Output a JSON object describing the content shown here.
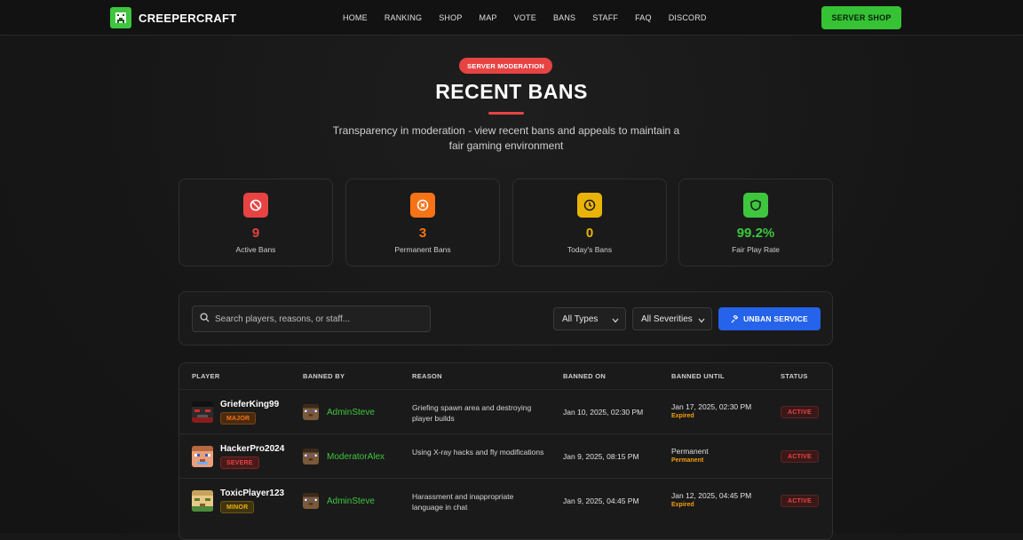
{
  "nav": {
    "brand": "CREEPERCRAFT",
    "items": [
      "HOME",
      "RANKING",
      "SHOP",
      "MAP",
      "VOTE",
      "BANS",
      "STAFF",
      "FAQ",
      "DISCORD"
    ],
    "cta": "SERVER SHOP"
  },
  "hero": {
    "badge": "SERVER MODERATION",
    "title": "RECENT BANS",
    "subtitle": "Transparency in moderation - view recent bans and appeals to maintain a fair gaming environment"
  },
  "stats": [
    {
      "value": "9",
      "label": "Active Bans",
      "icon": "ban-icon",
      "color": "#e74343"
    },
    {
      "value": "3",
      "label": "Permanent Bans",
      "icon": "x-circle-icon",
      "color": "#f97316"
    },
    {
      "value": "0",
      "label": "Today's Bans",
      "icon": "clock-icon",
      "color": "#eab308"
    },
    {
      "value": "99.2%",
      "label": "Fair Play Rate",
      "icon": "shield-icon",
      "color": "#3ec63e"
    }
  ],
  "filters": {
    "search_placeholder": "Search players, reasons, or staff...",
    "type_select": "All Types",
    "severity_select": "All Severities",
    "unban_label": "UNBAN SERVICE"
  },
  "table": {
    "headers": [
      "PLAYER",
      "BANNED BY",
      "REASON",
      "BANNED ON",
      "BANNED UNTIL",
      "STATUS"
    ],
    "rows": [
      {
        "player": "GrieferKing99",
        "severity": "MAJOR",
        "staff": "AdminSteve",
        "reason": "Griefing spawn area and destroying player builds",
        "banned_on": "Jan 10, 2025, 02:30 PM",
        "until": "Jan 17, 2025, 02:30 PM",
        "until_note": "Expired",
        "status": "ACTIVE"
      },
      {
        "player": "HackerPro2024",
        "severity": "SEVERE",
        "staff": "ModeratorAlex",
        "reason": "Using X-ray hacks and fly modifications",
        "banned_on": "Jan 9, 2025, 08:15 PM",
        "until": "Permanent",
        "until_note": "Permanent",
        "status": "ACTIVE"
      },
      {
        "player": "ToxicPlayer123",
        "severity": "MINOR",
        "staff": "AdminSteve",
        "reason": "Harassment and inappropriate language in chat",
        "banned_on": "Jan 9, 2025, 04:45 PM",
        "until": "Jan 12, 2025, 04:45 PM",
        "until_note": "Expired",
        "status": "ACTIVE"
      }
    ]
  },
  "colors": {
    "accent_green": "#3ec63e",
    "accent_red": "#e74343",
    "accent_blue": "#2563eb",
    "severity_major": "#f97316",
    "severity_severe": "#e74343",
    "severity_minor": "#eab308"
  }
}
